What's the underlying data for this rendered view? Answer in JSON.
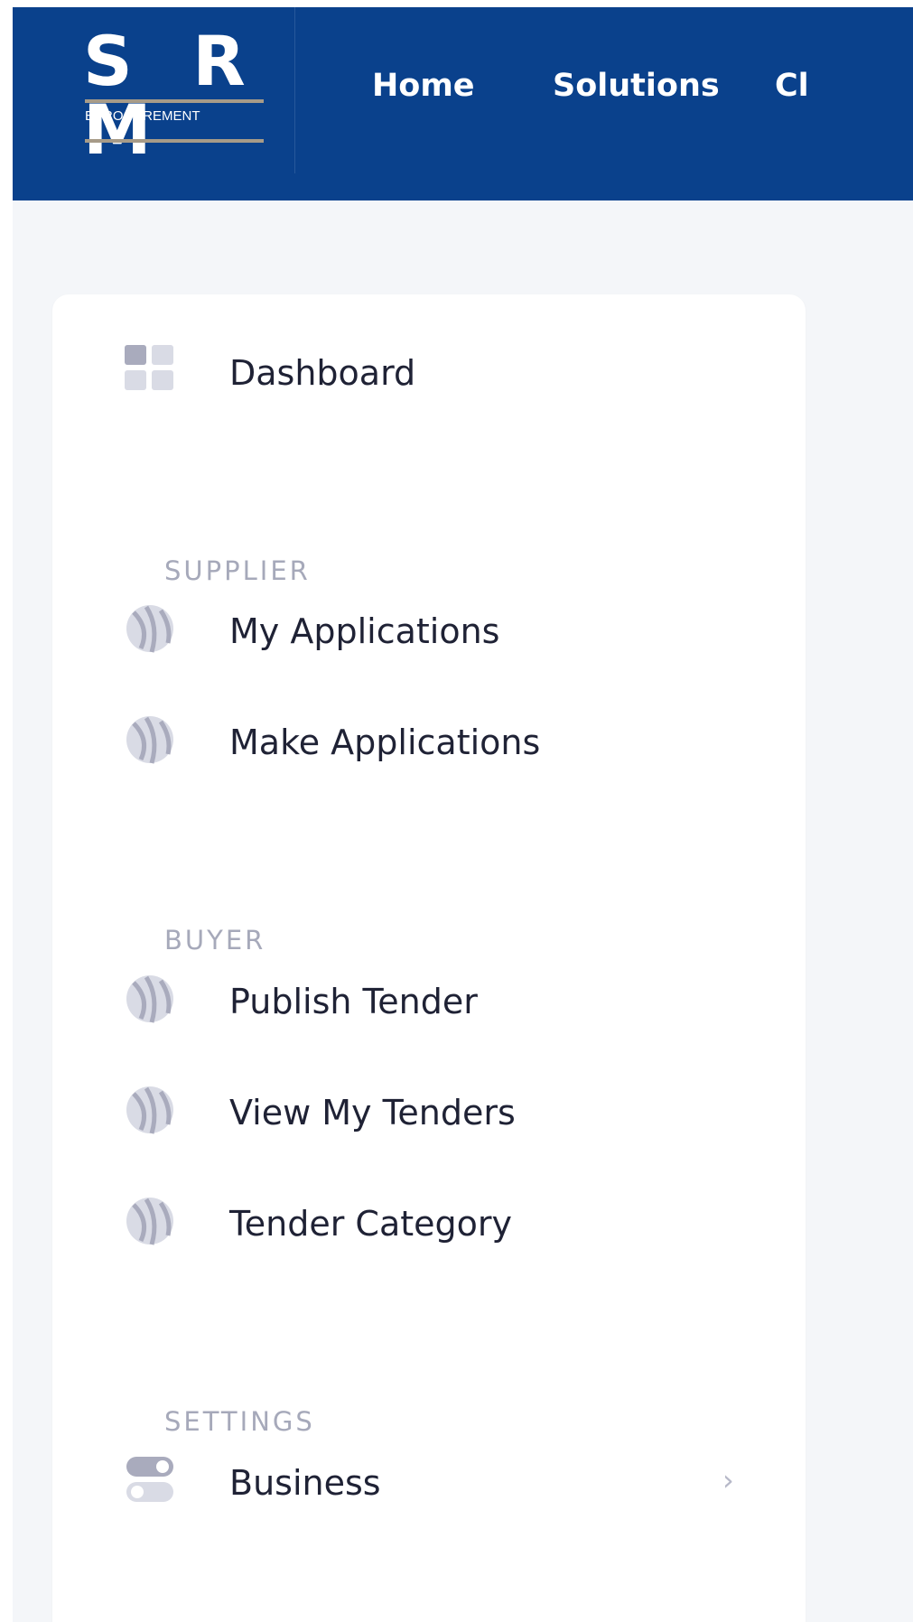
{
  "logo": {
    "letters": "S R M",
    "subtitle": "EPROCUREMENT"
  },
  "nav": {
    "items": [
      {
        "label": "Home"
      },
      {
        "label": "Solutions"
      },
      {
        "label": "Cl"
      }
    ]
  },
  "sidebar": {
    "dashboard": {
      "label": "Dashboard",
      "icon": "dashboard-grid-icon"
    },
    "sections": [
      {
        "title": "SUPPLIER",
        "items": [
          {
            "label": "My Applications",
            "icon": "abstract-sphere-icon"
          },
          {
            "label": "Make Applications",
            "icon": "abstract-sphere-icon"
          }
        ]
      },
      {
        "title": "BUYER",
        "items": [
          {
            "label": "Publish Tender",
            "icon": "abstract-sphere-icon"
          },
          {
            "label": "View My Tenders",
            "icon": "abstract-sphere-icon"
          },
          {
            "label": "Tender Category",
            "icon": "abstract-sphere-icon"
          }
        ]
      },
      {
        "title": "SETTINGS",
        "items": [
          {
            "label": "Business",
            "icon": "toggle-icon",
            "has_submenu": true
          }
        ]
      }
    ]
  },
  "colors": {
    "topbar": "#0a418c",
    "page_background": "#f4f6f9",
    "card_background": "#ffffff",
    "menu_text": "#1f2235",
    "section_text": "#a6a9ba",
    "icon_light": "#d9dbe5",
    "icon_dark": "#a9abbd",
    "logo_bar": "#a79b88"
  }
}
